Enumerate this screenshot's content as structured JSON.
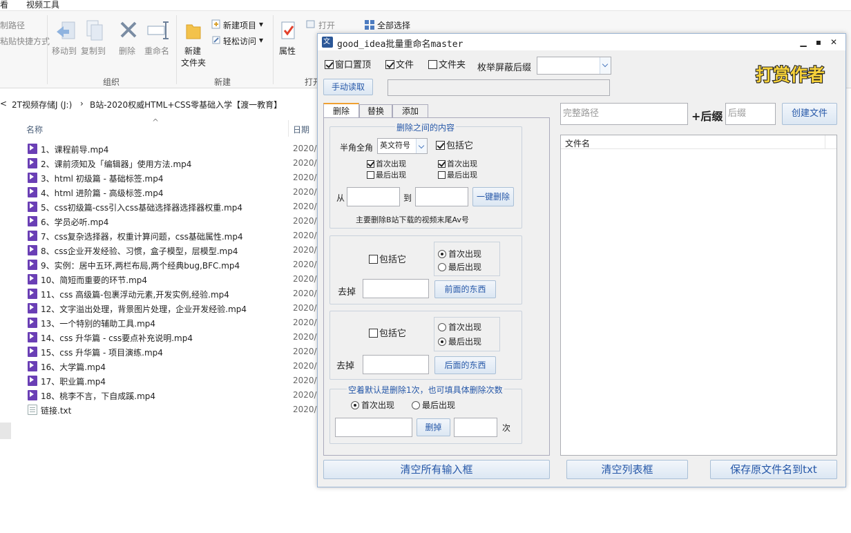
{
  "explorer": {
    "tabs": [
      "看",
      "视频工具"
    ],
    "ribbon": {
      "clipboard_items": [
        "制路径",
        "粘贴快捷方式"
      ],
      "organize": {
        "move_to": "移动到",
        "copy_to": "复制到",
        "delete": "删除",
        "rename": "重命名",
        "group": "组织"
      },
      "new": {
        "new_folder": "新建\n文件夹",
        "new_folder_l1": "新建",
        "new_folder_l2": "文件夹",
        "new_item": "新建项目",
        "easy_access": "轻松访问",
        "group": "新建"
      },
      "open": {
        "properties": "属性",
        "open": "打开",
        "group": "打开"
      },
      "select": {
        "select_all": "全部选择"
      }
    },
    "address": {
      "drive": "2T视频存储J (J:)",
      "folder": "B站-2020权威HTML+CSS零基础入学【渡一教育】"
    },
    "columns": {
      "name": "名称",
      "date": "日期"
    },
    "files": [
      {
        "name": "1、课程前导.mp4",
        "date": "2020/"
      },
      {
        "name": "2、课前须知及「编辑器」使用方法.mp4",
        "date": "2020/"
      },
      {
        "name": "3、html 初级篇 - 基础标签.mp4",
        "date": "2020/"
      },
      {
        "name": "4、html 进阶篇 - 高级标签.mp4",
        "date": "2020/"
      },
      {
        "name": "5、css初级篇-css引入css基础选择器选择器权重.mp4",
        "date": "2020/"
      },
      {
        "name": "6、学员必听.mp4",
        "date": "2020/"
      },
      {
        "name": "7、css复杂选择器，权重计算问题，css基础属性.mp4",
        "date": "2020/"
      },
      {
        "name": "8、css企业开发经验、习惯，盒子模型，层模型.mp4",
        "date": "2020/"
      },
      {
        "name": "9、实例：居中五环,两栏布局,两个经典bug,BFC.mp4",
        "date": "2020/"
      },
      {
        "name": "10、简短而重要的环节.mp4",
        "date": "2020/"
      },
      {
        "name": "11、css 高级篇-包裹浮动元素,开发实例,经验.mp4",
        "date": "2020/"
      },
      {
        "name": "12、文字溢出处理，背景图片处理，企业开发经验.mp4",
        "date": "2020/"
      },
      {
        "name": "13、一个特别的辅助工具.mp4",
        "date": "2020/"
      },
      {
        "name": "14、css 升华篇 - css要点补充说明.mp4",
        "date": "2020/"
      },
      {
        "name": "15、css 升华篇 - 项目演练.mp4",
        "date": "2020/"
      },
      {
        "name": "16、大学篇.mp4",
        "date": "2020/"
      },
      {
        "name": "17、职业篇.mp4",
        "date": "2020/"
      },
      {
        "name": "18、桃李不言，下自成蹊.mp4",
        "date": "2020/"
      },
      {
        "name": "链接.txt",
        "date": "2020/",
        "type": "txt"
      }
    ]
  },
  "app": {
    "title": "good_idea批量重命名master",
    "options": {
      "topmost": "窗口置顶",
      "file": "文件",
      "folder": "文件夹",
      "suffix_label": "枚举屏蔽后缀",
      "manual_read": "手动读取"
    },
    "donate": "打赏作者",
    "tabs": [
      "删除",
      "替换",
      "添加"
    ],
    "between": {
      "title": "删除之间的内容",
      "width_label": "半角全角",
      "width_value": "英文符号",
      "include": "包括它",
      "first": "首次出现",
      "last": "最后出现",
      "from": "从",
      "to": "到",
      "one_click": "一键删除",
      "hint": "主要删除B站下载的视频末尾Av号"
    },
    "before": {
      "include": "包括它",
      "first": "首次出现",
      "last": "最后出现",
      "remove": "去掉",
      "button": "前面的东西"
    },
    "after": {
      "include": "包括它",
      "first": "首次出现",
      "last": "最后出现",
      "remove": "去掉",
      "button": "后面的东西"
    },
    "count": {
      "title": "空着默认是删除1次，也可填具体删除次数",
      "first": "首次出现",
      "last": "最后出现",
      "delete": "删掉",
      "times": "次"
    },
    "right": {
      "full_path_placeholder": "完整路径",
      "suffix_label": "+后缀",
      "suffix_placeholder": "后缀",
      "create_file": "创建文件",
      "list_header": "文件名"
    },
    "bottom": {
      "clear_inputs": "清空所有输入框",
      "clear_list": "清空列表框",
      "save_txt": "保存原文件名到txt"
    }
  },
  "colors": {
    "accent": "#2557a8",
    "tab_highlight": "#f0a030",
    "video_icon": "#6a3fb5"
  }
}
